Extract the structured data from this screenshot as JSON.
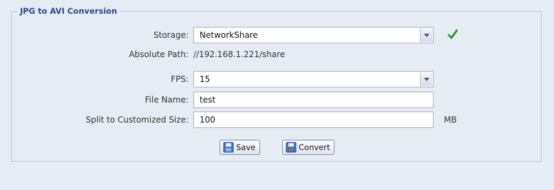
{
  "panel": {
    "title": "JPG to AVI Conversion"
  },
  "form": {
    "storage": {
      "label": "Storage:",
      "value": "NetworkShare",
      "status_icon": "check-icon",
      "status_color": "#2e9a2e"
    },
    "absolute_path": {
      "label": "Absolute Path:",
      "value": "//192.168.1.221/share"
    },
    "fps": {
      "label": "FPS:",
      "value": "15"
    },
    "file_name": {
      "label": "File Name:",
      "value": "test"
    },
    "split_size": {
      "label": "Split to Customized Size:",
      "value": "100",
      "unit": "MB"
    }
  },
  "buttons": {
    "save": {
      "label": "Save",
      "icon": "floppy-disk-icon"
    },
    "convert": {
      "label": "Convert",
      "icon": "convert-icon"
    }
  }
}
